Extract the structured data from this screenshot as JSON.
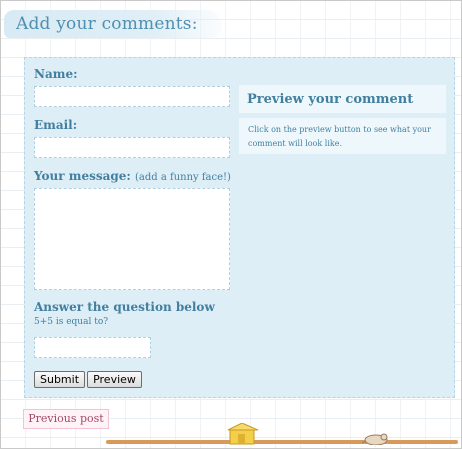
{
  "comments": {
    "heading": "Add your comments:",
    "name_label": "Name:",
    "email_label": "Email:",
    "message_label": "Your message:",
    "message_hint": "(add a funny face!)",
    "question_label": "Answer the question below",
    "question_text": "5+5 is equal to?",
    "submit_label": "Submit",
    "preview_label": "Preview"
  },
  "preview": {
    "title": "Preview your comment",
    "text": "Click on the preview button to see what your comment will look like."
  },
  "nav": {
    "previous_post": "Previous post"
  },
  "colors": {
    "accent": "#427f9f",
    "panel": "#ddeef7",
    "preview_bg": "#eef8fc"
  }
}
